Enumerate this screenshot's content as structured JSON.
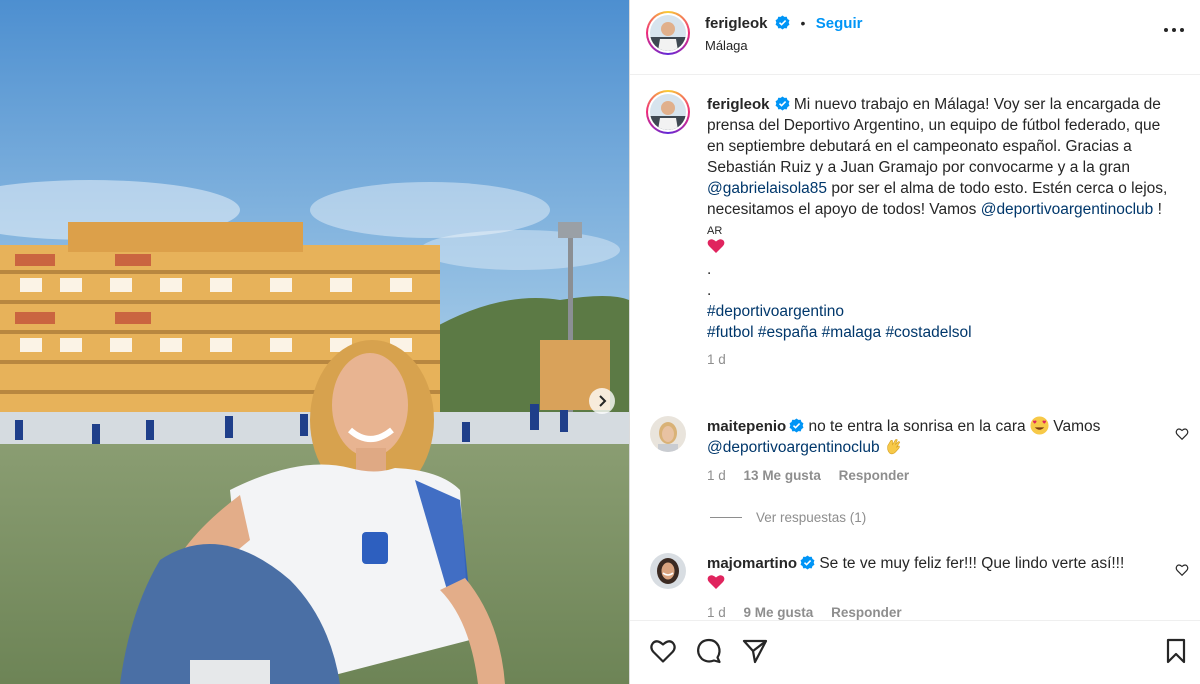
{
  "post": {
    "username": "ferigleok",
    "follow_label": "Seguir",
    "location": "Málaga",
    "caption": {
      "username": "ferigleok",
      "text_1": "Mi nuevo trabajo en Málaga! Voy ser la encargada de prensa del Deportivo Argentino, un equipo de fútbol federado, que en septiembre debutará en el campeonato español. Gracias a Sebastián Ruiz y a Juan Gramajo por convocarme y a la gran ",
      "mention_1": "@gabrielaisola85",
      "text_2": " por ser el alma de todo esto. Estén cerca o lejos, necesitamos el apoyo de todos! Vamos ",
      "mention_2": "@deportivoargentinoclub",
      "text_3": " !",
      "ar_label": "AR",
      "dot_1": ".",
      "dot_2": ".",
      "hashtag_line_1": [
        "#deportivoargentino"
      ],
      "hashtag_line_2": [
        "#futbol",
        "#españa",
        "#malaga",
        "#costadelsol"
      ],
      "time": "1 d"
    },
    "comments": [
      {
        "username": "maitepenio",
        "text_1": "no te entra la sonrisa en la cara",
        "text_2": " Vamos ",
        "mention": "@deportivoargentinoclub",
        "time": "1 d",
        "likes": "13 Me gusta",
        "reply_label": "Responder",
        "view_replies": "Ver respuestas (1)"
      },
      {
        "username": "majomartino",
        "text": "Se te ve muy feliz fer!!! Que lindo verte así!!!",
        "time": "1 d",
        "likes": "9 Me gusta",
        "reply_label": "Responder"
      }
    ]
  },
  "icons": {
    "verified": "verified-badge-icon",
    "more": "more-options-icon",
    "like": "heart-icon",
    "comment": "comment-icon",
    "share": "send-icon",
    "save": "bookmark-icon",
    "next": "chevron-right-icon"
  },
  "colors": {
    "link": "#00376b",
    "follow": "#0095f6",
    "verified": "#0095f6",
    "muted": "#8e8e8e"
  }
}
